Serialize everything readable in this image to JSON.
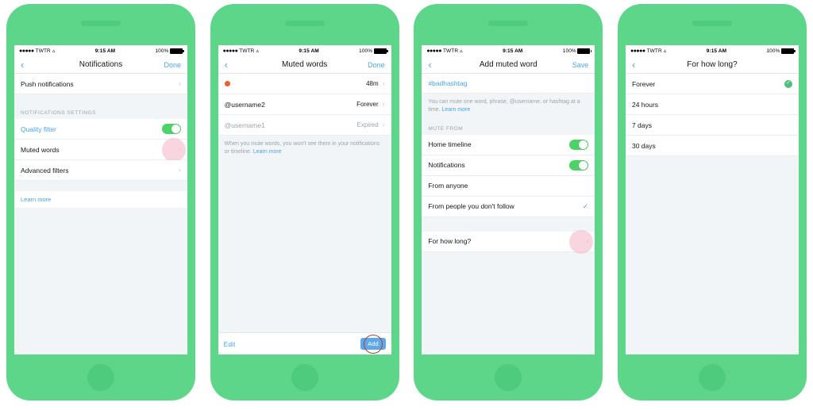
{
  "status_bar": {
    "signal": "●●●●●",
    "carrier": "TWTR",
    "wifi_icon": "wifi-icon",
    "time": "9:15 AM",
    "battery_label": "100%"
  },
  "colors": {
    "phone_body": "#5ED68A",
    "accent_blue": "#4AA3E5",
    "toggle_green": "#4CD267",
    "check_green": "#4BC17A",
    "emoji_orange": "#E8622A",
    "tap_pink": "#F4B4C4",
    "annotation_red": "#A2413F"
  },
  "screens": [
    {
      "id": "notifications",
      "nav": {
        "back_icon": "chevron-left-icon",
        "title": "Notifications",
        "action": "Done"
      },
      "rows": [
        {
          "type": "link-row",
          "label": "Push notifications",
          "accessory": "chevron"
        }
      ],
      "section_header": "NOTIFICATIONS SETTINGS",
      "settings_rows": [
        {
          "label": "Quality filter",
          "style": "link",
          "accessory": "toggle",
          "toggle_on": true
        },
        {
          "label": "Muted words",
          "style": "plain",
          "accessory": "chevron",
          "tap_highlight": true
        },
        {
          "label": "Advanced filters",
          "style": "plain",
          "accessory": "chevron"
        }
      ],
      "learn_more": "Learn more"
    },
    {
      "id": "muted-words",
      "nav": {
        "back_icon": "chevron-left-icon",
        "title": "Muted words",
        "action": "Done"
      },
      "items": [
        {
          "label": "",
          "emoji": "orange-dot-icon",
          "value": "48m",
          "expired": false
        },
        {
          "label": "@username2",
          "value": "Forever",
          "expired": false
        },
        {
          "label": "@username1",
          "value": "Expired",
          "expired": true
        }
      ],
      "footnote": "When you mute words, you won't see them in your notifications or timeline.",
      "footnote_link": "Learn more",
      "bottom_bar": {
        "edit": "Edit",
        "add": "Add"
      }
    },
    {
      "id": "add-muted-word",
      "nav": {
        "back_icon": "chevron-left-icon",
        "title": "Add muted word",
        "action": "Save"
      },
      "field_value": "#badhashtag",
      "field_hint": "You can mute one word, phrase, @username, or hashtag at a time.",
      "field_hint_link": "Learn more",
      "section_header": "MUTE FROM",
      "rows": [
        {
          "label": "Home timeline",
          "accessory": "toggle",
          "toggle_on": true
        },
        {
          "label": "Notifications",
          "accessory": "toggle",
          "toggle_on": true
        },
        {
          "label": "From anyone",
          "accessory": "none"
        },
        {
          "label": "From people you don't follow",
          "accessory": "check"
        }
      ],
      "duration_row": {
        "label": "For how long?",
        "accessory": "chevron",
        "tap_highlight": true
      }
    },
    {
      "id": "for-how-long",
      "nav": {
        "back_icon": "chevron-left-icon",
        "title": "For how long?",
        "action": ""
      },
      "options": [
        {
          "label": "Forever",
          "selected": true
        },
        {
          "label": "24 hours",
          "selected": false
        },
        {
          "label": "7 days",
          "selected": false
        },
        {
          "label": "30 days",
          "selected": false
        }
      ]
    }
  ]
}
